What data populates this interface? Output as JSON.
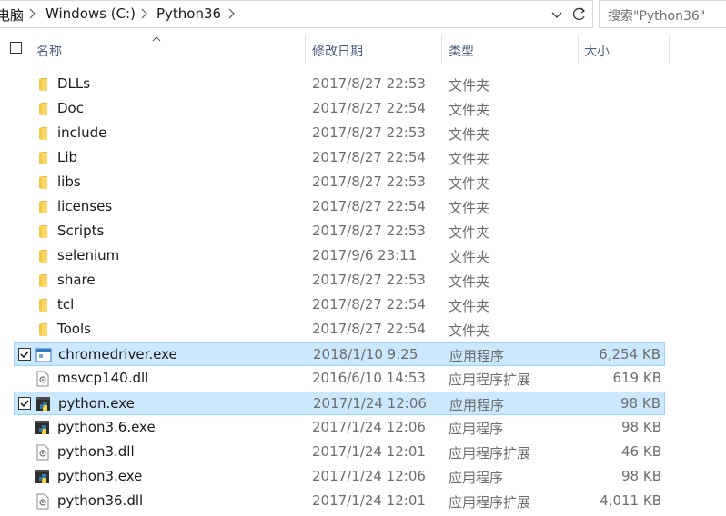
{
  "breadcrumb": {
    "part0": "电脑",
    "part1": "Windows (C:)",
    "part2": "Python36"
  },
  "search": {
    "placeholder": "搜索\"Python36\""
  },
  "columns": {
    "name": "名称",
    "date": "修改日期",
    "type": "类型",
    "size": "大小"
  },
  "files": [
    {
      "name": "DLLs",
      "date": "2017/8/27 22:53",
      "type": "文件夹",
      "size": "",
      "icon": "folder-icon",
      "selected": false
    },
    {
      "name": "Doc",
      "date": "2017/8/27 22:54",
      "type": "文件夹",
      "size": "",
      "icon": "folder-icon",
      "selected": false
    },
    {
      "name": "include",
      "date": "2017/8/27 22:53",
      "type": "文件夹",
      "size": "",
      "icon": "folder-icon",
      "selected": false
    },
    {
      "name": "Lib",
      "date": "2017/8/27 22:54",
      "type": "文件夹",
      "size": "",
      "icon": "folder-icon",
      "selected": false
    },
    {
      "name": "libs",
      "date": "2017/8/27 22:53",
      "type": "文件夹",
      "size": "",
      "icon": "folder-icon",
      "selected": false
    },
    {
      "name": "licenses",
      "date": "2017/8/27 22:54",
      "type": "文件夹",
      "size": "",
      "icon": "folder-icon",
      "selected": false
    },
    {
      "name": "Scripts",
      "date": "2017/8/27 22:53",
      "type": "文件夹",
      "size": "",
      "icon": "folder-icon",
      "selected": false
    },
    {
      "name": "selenium",
      "date": "2017/9/6 23:11",
      "type": "文件夹",
      "size": "",
      "icon": "folder-icon",
      "selected": false
    },
    {
      "name": "share",
      "date": "2017/8/27 22:53",
      "type": "文件夹",
      "size": "",
      "icon": "folder-icon",
      "selected": false
    },
    {
      "name": "tcl",
      "date": "2017/8/27 22:54",
      "type": "文件夹",
      "size": "",
      "icon": "folder-icon",
      "selected": false
    },
    {
      "name": "Tools",
      "date": "2017/8/27 22:54",
      "type": "文件夹",
      "size": "",
      "icon": "folder-icon",
      "selected": false
    },
    {
      "name": "chromedriver.exe",
      "date": "2018/1/10 9:25",
      "type": "应用程序",
      "size": "6,254 KB",
      "icon": "exe-window-icon",
      "selected": true
    },
    {
      "name": "msvcp140.dll",
      "date": "2016/6/10 14:53",
      "type": "应用程序扩展",
      "size": "619 KB",
      "icon": "dll-icon",
      "selected": false
    },
    {
      "name": "python.exe",
      "date": "2017/1/24 12:06",
      "type": "应用程序",
      "size": "98 KB",
      "icon": "python-icon",
      "selected": true
    },
    {
      "name": "python3.6.exe",
      "date": "2017/1/24 12:06",
      "type": "应用程序",
      "size": "98 KB",
      "icon": "python-icon",
      "selected": false
    },
    {
      "name": "python3.dll",
      "date": "2017/1/24 12:01",
      "type": "应用程序扩展",
      "size": "46 KB",
      "icon": "dll-icon",
      "selected": false
    },
    {
      "name": "python3.exe",
      "date": "2017/1/24 12:06",
      "type": "应用程序",
      "size": "98 KB",
      "icon": "python-icon",
      "selected": false
    },
    {
      "name": "python36.dll",
      "date": "2017/1/24 12:01",
      "type": "应用程序扩展",
      "size": "4,011 KB",
      "icon": "dll-icon",
      "selected": false
    }
  ]
}
